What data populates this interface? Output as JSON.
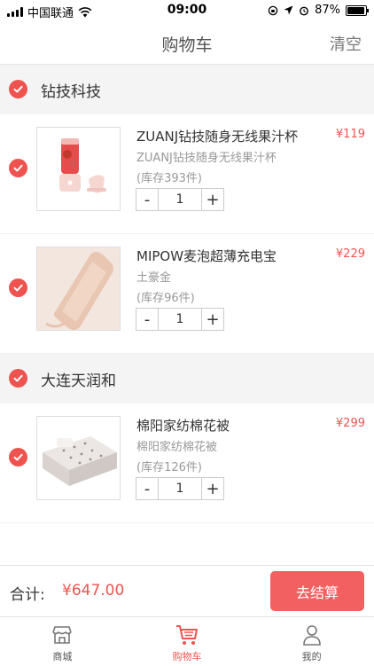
{
  "status_bar": {
    "carrier": "中国联通",
    "time": "09:00",
    "battery": "87%",
    "battery_level": 0.87
  },
  "header": {
    "title": "购物车",
    "clear_label": "清空"
  },
  "shops": [
    {
      "name": "钻技科技",
      "items": [
        {
          "title": "ZUANJ钻技随身无线果汁杯",
          "subtitle": "ZUANJ钻技随身无线果汁杯",
          "stock": "(库存393件)",
          "price": "¥119",
          "qty": "1",
          "minus": "-",
          "plus": "+"
        },
        {
          "title": "MIPOW麦泡超薄充电宝",
          "subtitle": "土豪金",
          "stock": "(库存96件)",
          "price": "¥229",
          "qty": "1",
          "minus": "-",
          "plus": "+"
        }
      ]
    },
    {
      "name": "大连天润和",
      "items": [
        {
          "title": "棉阳家纺棉花被",
          "subtitle": "棉阳家纺棉花被",
          "stock": "(库存126件)",
          "price": "¥299",
          "qty": "1",
          "minus": "-",
          "plus": "+"
        }
      ]
    }
  ],
  "checkout": {
    "total_label": "合计:",
    "total_value": "¥647.00",
    "button_label": "去结算"
  },
  "tab_bar": {
    "tabs": [
      {
        "label": "商城",
        "icon": "store-icon"
      },
      {
        "label": "购物车",
        "icon": "cart-icon"
      },
      {
        "label": "我的",
        "icon": "user-icon"
      }
    ],
    "active_index": 1
  },
  "colors": {
    "accent": "#ef5350",
    "checkout_button": "#f36062",
    "shop_header_bg": "#f4f4f4"
  }
}
